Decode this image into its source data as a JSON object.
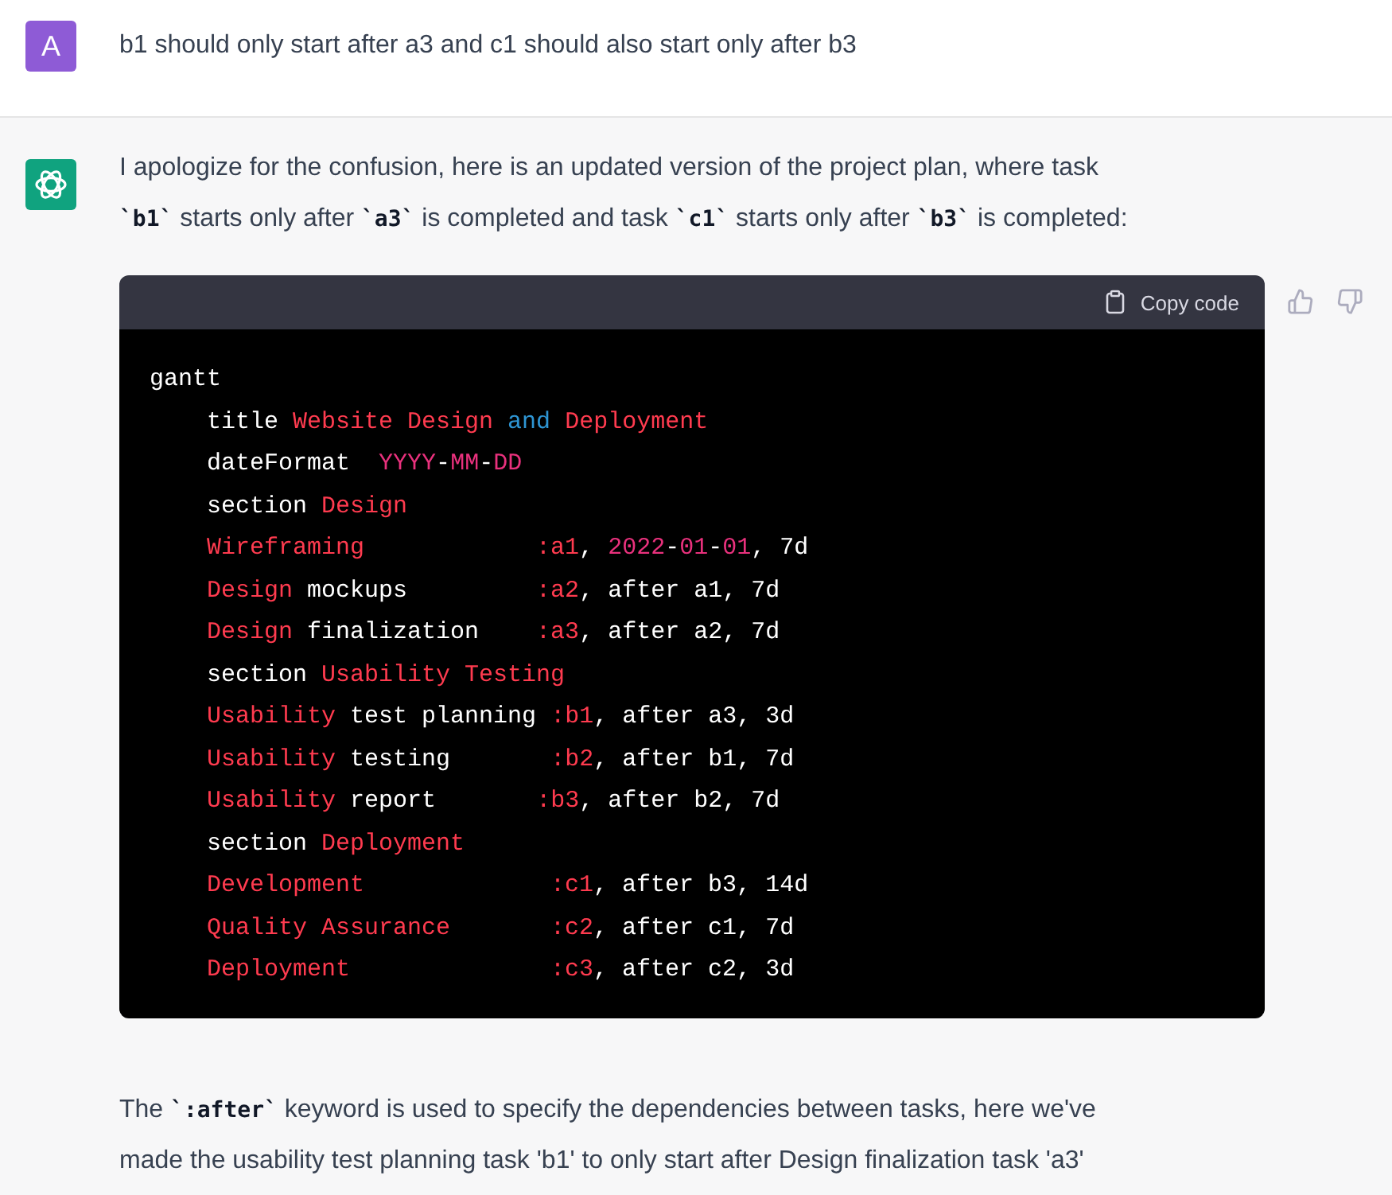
{
  "user_message": {
    "avatar_letter": "A",
    "text": "b1 should only start after a3 and c1 should also start only after b3"
  },
  "assistant_message": {
    "intro": [
      {
        "kind": "text",
        "text": "I apologize for the confusion, here is an updated version of the project plan, where task "
      },
      {
        "kind": "code",
        "text": "`b1`"
      },
      {
        "kind": "text",
        "text": " starts only after "
      },
      {
        "kind": "code",
        "text": "`a3`"
      },
      {
        "kind": "text",
        "text": " is completed and task "
      },
      {
        "kind": "code",
        "text": "`c1`"
      },
      {
        "kind": "text",
        "text": " starts only after "
      },
      {
        "kind": "code",
        "text": "`b3`"
      },
      {
        "kind": "text",
        "text": " is completed:"
      }
    ],
    "code_block": {
      "copy_label": "Copy code",
      "lines": [
        [
          {
            "kind": "plain",
            "text": "gantt"
          }
        ],
        [
          {
            "kind": "plain",
            "text": "    title "
          },
          {
            "kind": "red",
            "text": "Website Design "
          },
          {
            "kind": "blue",
            "text": "and"
          },
          {
            "kind": "red",
            "text": " Deployment"
          }
        ],
        [
          {
            "kind": "plain",
            "text": "    dateFormat  "
          },
          {
            "kind": "pink",
            "text": "YYYY"
          },
          {
            "kind": "plain",
            "text": "-"
          },
          {
            "kind": "pink",
            "text": "MM"
          },
          {
            "kind": "plain",
            "text": "-"
          },
          {
            "kind": "pink",
            "text": "DD"
          }
        ],
        [
          {
            "kind": "plain",
            "text": "    section "
          },
          {
            "kind": "red",
            "text": "Design"
          }
        ],
        [
          {
            "kind": "red",
            "text": "    Wireframing            :a1"
          },
          {
            "kind": "plain",
            "text": ", "
          },
          {
            "kind": "pink",
            "text": "2022"
          },
          {
            "kind": "plain",
            "text": "-"
          },
          {
            "kind": "pink",
            "text": "01"
          },
          {
            "kind": "plain",
            "text": "-"
          },
          {
            "kind": "pink",
            "text": "01"
          },
          {
            "kind": "plain",
            "text": ", 7d"
          }
        ],
        [
          {
            "kind": "red",
            "text": "    Design"
          },
          {
            "kind": "plain",
            "text": " mockups         "
          },
          {
            "kind": "red",
            "text": ":a2"
          },
          {
            "kind": "plain",
            "text": ", after a1, 7d"
          }
        ],
        [
          {
            "kind": "red",
            "text": "    Design"
          },
          {
            "kind": "plain",
            "text": " finalization    "
          },
          {
            "kind": "red",
            "text": ":a3"
          },
          {
            "kind": "plain",
            "text": ", after a2, 7d"
          }
        ],
        [
          {
            "kind": "plain",
            "text": "    section "
          },
          {
            "kind": "red",
            "text": "Usability Testing"
          }
        ],
        [
          {
            "kind": "red",
            "text": "    Usability"
          },
          {
            "kind": "plain",
            "text": " test planning "
          },
          {
            "kind": "red",
            "text": ":b1"
          },
          {
            "kind": "plain",
            "text": ", after a3, 3d"
          }
        ],
        [
          {
            "kind": "red",
            "text": "    Usability"
          },
          {
            "kind": "plain",
            "text": " testing       "
          },
          {
            "kind": "red",
            "text": ":b2"
          },
          {
            "kind": "plain",
            "text": ", after b1, 7d"
          }
        ],
        [
          {
            "kind": "red",
            "text": "    Usability"
          },
          {
            "kind": "plain",
            "text": " report       "
          },
          {
            "kind": "red",
            "text": ":b3"
          },
          {
            "kind": "plain",
            "text": ", after b2, 7d"
          }
        ],
        [
          {
            "kind": "plain",
            "text": "    section "
          },
          {
            "kind": "red",
            "text": "Deployment"
          }
        ],
        [
          {
            "kind": "red",
            "text": "    Development             :c1"
          },
          {
            "kind": "plain",
            "text": ", after b3, 14d"
          }
        ],
        [
          {
            "kind": "red",
            "text": "    Quality Assurance       :c2"
          },
          {
            "kind": "plain",
            "text": ", after c1, 7d"
          }
        ],
        [
          {
            "kind": "red",
            "text": "    Deployment              :c3"
          },
          {
            "kind": "plain",
            "text": ", after c2, 3d"
          }
        ]
      ]
    },
    "outro_lines": [
      [
        {
          "kind": "text",
          "text": "The "
        },
        {
          "kind": "code",
          "text": "`:after`"
        },
        {
          "kind": "text",
          "text": " keyword is used to specify the dependencies between tasks, here we've"
        }
      ],
      [
        {
          "kind": "text",
          "text": "made the usability test planning task 'b1' to only start after Design finalization task 'a3'"
        }
      ]
    ]
  }
}
